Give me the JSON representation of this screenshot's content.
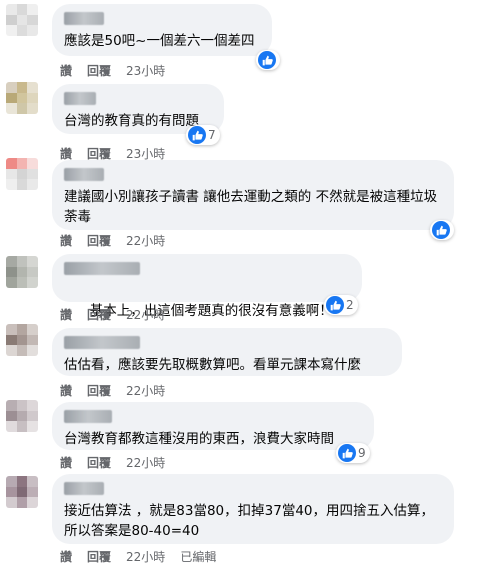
{
  "comments": [
    {
      "text": "應該是50吧~一個差六一個差四",
      "actions": [
        "讚",
        "回覆",
        "23小時"
      ],
      "reaction_count": ""
    },
    {
      "text": "台灣的教育真的有問題",
      "actions": [
        "讚",
        "回覆",
        "23小時"
      ],
      "reaction_count": "7"
    },
    {
      "text": "建議國小別讓孩子讀書 讓他去運動之類的 不然就是被這種垃圾荼毒",
      "actions": [
        "讚",
        "回覆",
        "22小時"
      ],
      "reaction_count": ""
    },
    {
      "text": "基本上，出這個考題真的很沒有意義啊！",
      "actions": [
        "讚",
        "回覆",
        "22小時"
      ],
      "reaction_count": "2"
    },
    {
      "text": "估估看，應該要先取概數算吧。看單元課本寫什麼",
      "actions": [
        "讚",
        "回覆",
        "22小時"
      ],
      "reaction_count": ""
    },
    {
      "text": "台灣教育都教這種沒用的東西，浪費大家時間",
      "actions": [
        "讚",
        "回覆",
        "22小時"
      ],
      "reaction_count": "9"
    },
    {
      "text": "接近估算法 ，就是83當80，扣掉37當40，用四捨五入估算，所以答案是80-40=40",
      "actions": [
        "讚",
        "回覆",
        "22小時",
        "已編輯"
      ],
      "reaction_count": ""
    }
  ],
  "colors": {
    "bubble": "#f0f2f5",
    "like_blue": "#1877f2",
    "meta_text": "#65676b"
  },
  "icons": [
    "like-icon",
    "woman-shrugging-emoji"
  ]
}
